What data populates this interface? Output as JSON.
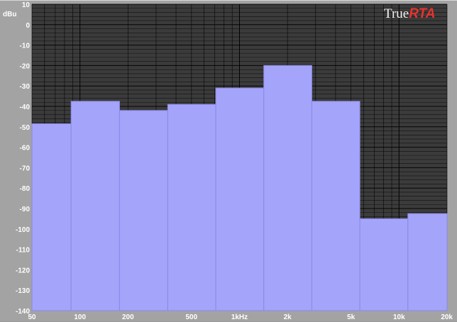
{
  "logo": {
    "part1": "True",
    "part2": "RTA"
  },
  "y_unit": "dBu",
  "colors": {
    "plot_bg": "#3b3b3b",
    "grid_minor": "#000000",
    "grid_major": "#000000",
    "bar_fill": "#a4a4fb",
    "bar_edge": "#8a8ae6",
    "frame": "#a3a3a3",
    "label_text": "#ffffff",
    "logo_red": "#e8322d"
  },
  "chart_data": {
    "type": "bar",
    "title": "",
    "xlabel": "",
    "ylabel": "dBu",
    "x_scale": "log",
    "xlim": [
      50,
      20000
    ],
    "ylim": [
      -140,
      10
    ],
    "y_ticks": [
      10,
      0,
      -10,
      -20,
      -30,
      -40,
      -50,
      -60,
      -70,
      -80,
      -90,
      -100,
      -110,
      -120,
      -130,
      -140
    ],
    "x_ticks": [
      {
        "value": 50,
        "label": "50"
      },
      {
        "value": 100,
        "label": "100"
      },
      {
        "value": 200,
        "label": "200"
      },
      {
        "value": 500,
        "label": "500"
      },
      {
        "value": 1000,
        "label": "1kHz"
      },
      {
        "value": 2000,
        "label": "2k"
      },
      {
        "value": 5000,
        "label": "5k"
      },
      {
        "value": 10000,
        "label": "10k"
      },
      {
        "value": 20000,
        "label": "20k"
      }
    ],
    "grid": true,
    "bands": [
      {
        "from": 50,
        "to": 88,
        "value": -48.5
      },
      {
        "from": 88,
        "to": 177,
        "value": -37.5
      },
      {
        "from": 177,
        "to": 355,
        "value": -42
      },
      {
        "from": 355,
        "to": 710,
        "value": -39
      },
      {
        "from": 710,
        "to": 1420,
        "value": -31
      },
      {
        "from": 1420,
        "to": 2840,
        "value": -20
      },
      {
        "from": 2840,
        "to": 5680,
        "value": -37.5
      },
      {
        "from": 5680,
        "to": 11360,
        "value": -95
      },
      {
        "from": 11360,
        "to": 20000,
        "value": -92.5
      }
    ]
  }
}
